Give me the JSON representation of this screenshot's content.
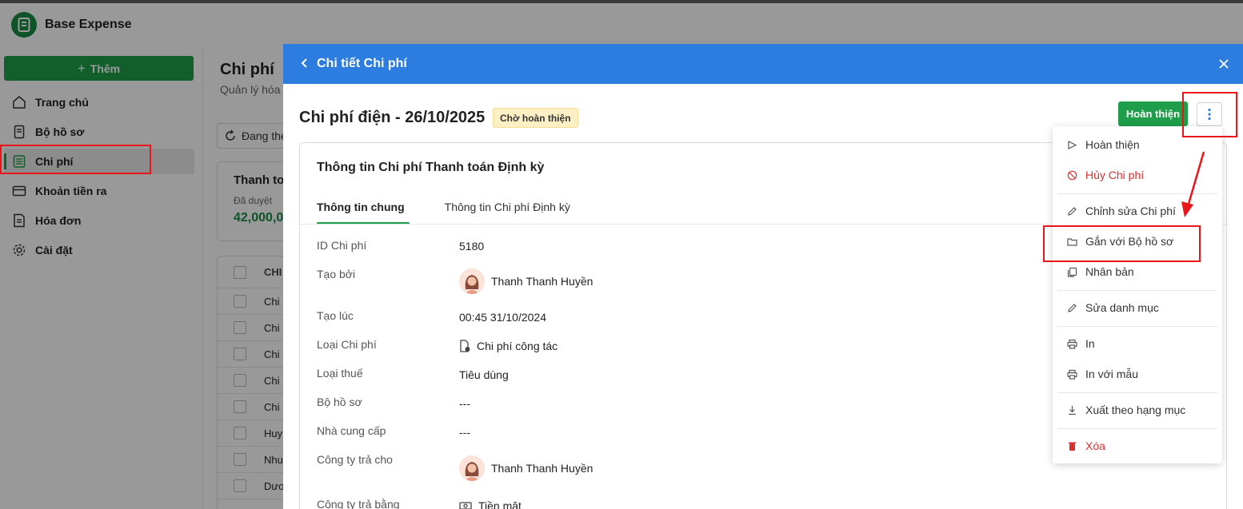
{
  "app": {
    "name": "Base Expense"
  },
  "sidebar": {
    "add_label": "Thêm",
    "items": [
      {
        "label": "Trang chủ",
        "icon": "home-icon"
      },
      {
        "label": "Bộ hồ sơ",
        "icon": "file-set-icon"
      },
      {
        "label": "Chi phí",
        "icon": "list-icon",
        "active": true
      },
      {
        "label": "Khoản tiền ra",
        "icon": "card-icon"
      },
      {
        "label": "Hóa đơn",
        "icon": "invoice-icon"
      },
      {
        "label": "Cài đặt",
        "icon": "gear-icon"
      }
    ]
  },
  "main": {
    "title": "Chi phí",
    "subtitle": "Quản lý hóa đ",
    "filter_label": "Đang the",
    "summary": {
      "title": "Thanh to",
      "label": "Đã duyệt",
      "value": "42,000,0"
    },
    "table_header": "CHI",
    "rows": [
      "Chi p",
      "Chi p",
      "Chi p",
      "Chi p",
      "Chi p",
      "Huy",
      "Nhu",
      "Dươ"
    ]
  },
  "drawer": {
    "title": "Chi tiết Chi phí",
    "doc_title": "Chi phí điện - 26/10/2025",
    "status": "Chờ hoàn thiện",
    "complete_label": "Hoàn thiện",
    "card_title": "Thông tin Chi phí Thanh toán Định kỳ",
    "tabs": [
      "Thông tin chung",
      "Thông tin Chi phí Định kỳ"
    ],
    "fields": [
      {
        "label": "ID Chi phí",
        "value": "5180"
      },
      {
        "label": "Tạo bởi",
        "value": "Thanh Thanh Huyền"
      },
      {
        "label": "Tạo lúc",
        "value": "00:45 31/10/2024"
      },
      {
        "label": "Loại Chi phí",
        "value": "Chi phí công tác"
      },
      {
        "label": "Loại thuế",
        "value": "Tiêu dùng"
      },
      {
        "label": "Bộ hồ sơ",
        "value": "---"
      },
      {
        "label": "Nhà cung cấp",
        "value": "---"
      },
      {
        "label": "Công ty trả cho",
        "value": "Thanh Thanh Huyền"
      },
      {
        "label": "Công ty trả bằng",
        "value": "Tiền mặt"
      }
    ]
  },
  "menu": {
    "items": [
      {
        "label": "Hoàn thiện",
        "icon": "send-icon"
      },
      {
        "label": "Hủy Chi phí",
        "icon": "ban-icon",
        "danger": true
      },
      {
        "label": "Chỉnh sửa Chi phí",
        "icon": "pencil-icon"
      },
      {
        "label": "Gắn với Bộ hồ sơ",
        "icon": "folder-icon"
      },
      {
        "label": "Nhân bản",
        "icon": "copy-icon"
      },
      {
        "label": "Sửa danh mục",
        "icon": "pencil-icon"
      },
      {
        "label": "In",
        "icon": "printer-icon"
      },
      {
        "label": "In với mẫu",
        "icon": "printer-icon"
      },
      {
        "label": "Xuất theo hạng mục",
        "icon": "download-icon"
      },
      {
        "label": "Xóa",
        "icon": "trash-icon",
        "danger": true
      }
    ]
  },
  "colors": {
    "accent_green": "#1e9e4a",
    "header_blue": "#2d7de0",
    "danger_red": "#d93030",
    "annotation_red": "#e8161b"
  }
}
